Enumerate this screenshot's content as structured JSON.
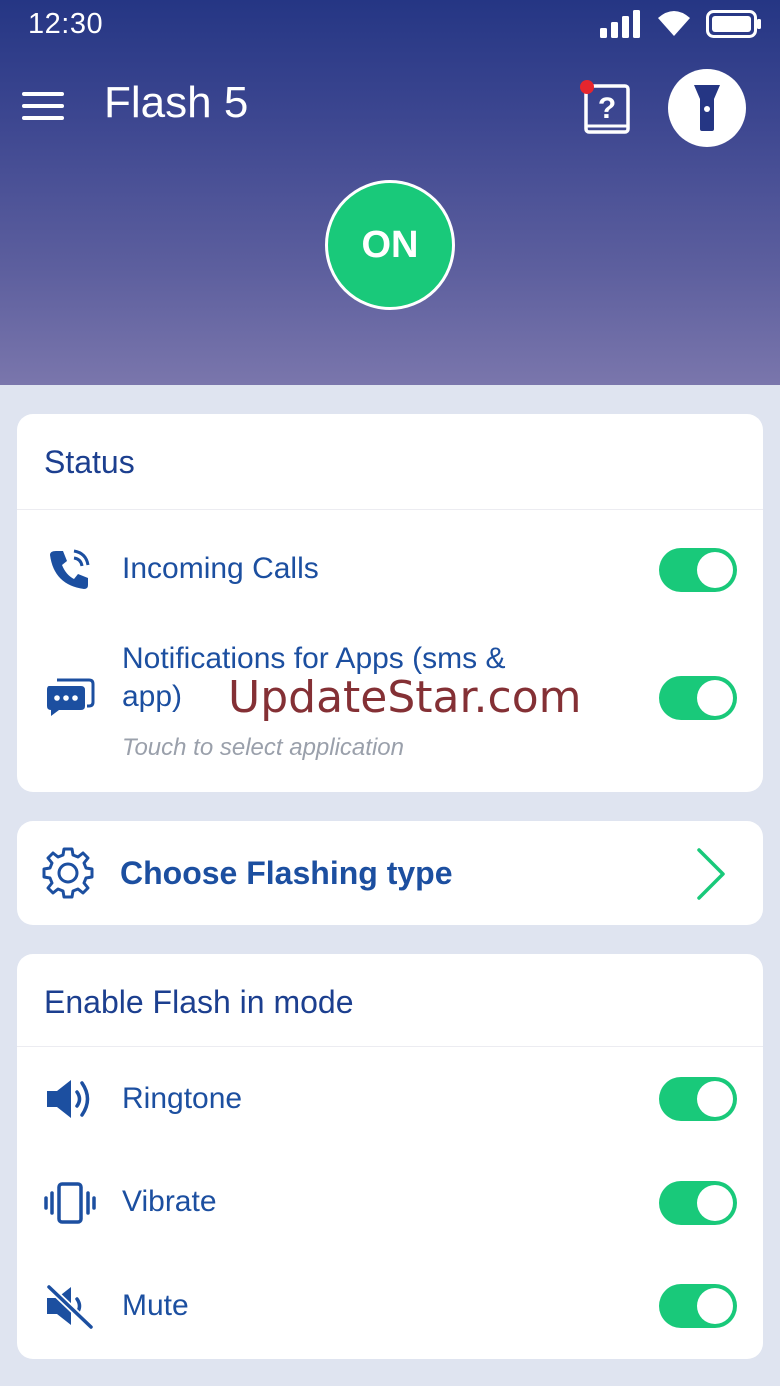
{
  "status_bar": {
    "time": "12:30"
  },
  "toolbar": {
    "title": "Flash 5"
  },
  "power": {
    "label": "ON",
    "color": "#19c97a"
  },
  "status_card": {
    "title": "Status",
    "items": [
      {
        "label": "Incoming Calls",
        "icon": "phone-ring-icon",
        "enabled": true
      },
      {
        "label_line1": "Notifications for Apps (sms &",
        "label_line2": "app)",
        "sublabel": "Touch to select application",
        "icon": "chat-icon",
        "enabled": true
      }
    ]
  },
  "flashing_card": {
    "label": "Choose Flashing type",
    "icon": "gear-icon"
  },
  "mode_card": {
    "title": "Enable Flash in mode",
    "items": [
      {
        "label": "Ringtone",
        "icon": "speaker-icon",
        "enabled": true
      },
      {
        "label": "Vibrate",
        "icon": "vibrate-icon",
        "enabled": true
      },
      {
        "label": "Mute",
        "icon": "mute-icon",
        "enabled": true
      }
    ]
  },
  "watermark": "UpdateStar.com",
  "colors": {
    "accent": "#19c97a",
    "primary_text": "#1c4fa0",
    "header_top": "#253684",
    "header_bottom": "#7a76ac"
  }
}
